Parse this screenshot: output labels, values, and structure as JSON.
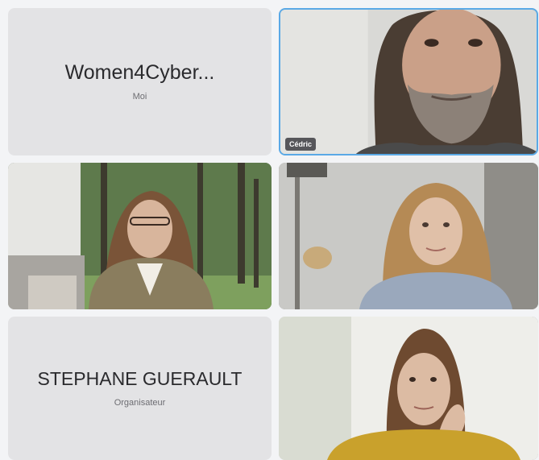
{
  "participants": [
    {
      "display_name": "Women4Cyber...",
      "role": "Moi",
      "video": false
    },
    {
      "label": "Cédric",
      "video": true,
      "active_speaker": true
    },
    {
      "label": "",
      "video": true
    },
    {
      "label": "",
      "video": true
    },
    {
      "display_name": "STEPHANE GUERAULT",
      "role": "Organisateur",
      "video": false
    },
    {
      "label": "",
      "video": true
    }
  ],
  "colors": {
    "tile_background": "#e3e3e5",
    "active_speaker_border": "#5aa9e6",
    "page_background": "#f3f4f6"
  }
}
